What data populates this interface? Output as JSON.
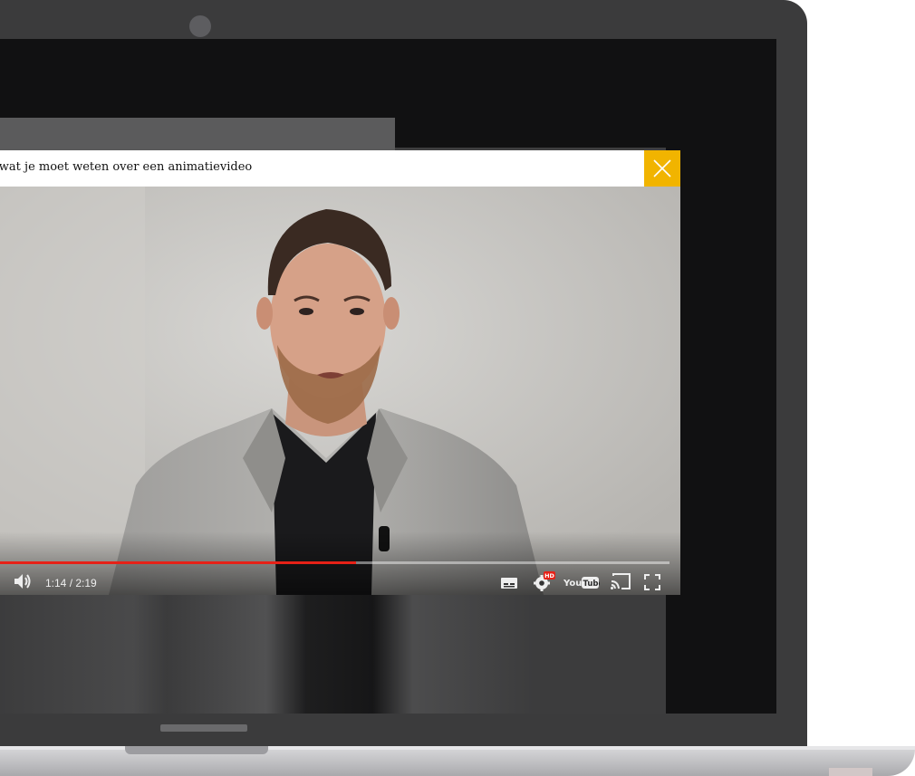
{
  "modal": {
    "title": "s wat je moet weten over een animatievideo",
    "close_icon": "close-icon"
  },
  "player": {
    "current_time": "1:14",
    "duration": "2:19",
    "time_display": "1:14 / 2:19",
    "progress_fraction": 0.532,
    "hd_badge": "HD",
    "youtube_logo": "YouTube",
    "controls": [
      "volume-icon",
      "subtitles-icon",
      "settings-icon",
      "youtube-logo",
      "cast-icon",
      "fullscreen-icon"
    ]
  },
  "colors": {
    "accent": "#f1b400",
    "progress": "#e62117",
    "bezel": "#3b3b3c"
  }
}
